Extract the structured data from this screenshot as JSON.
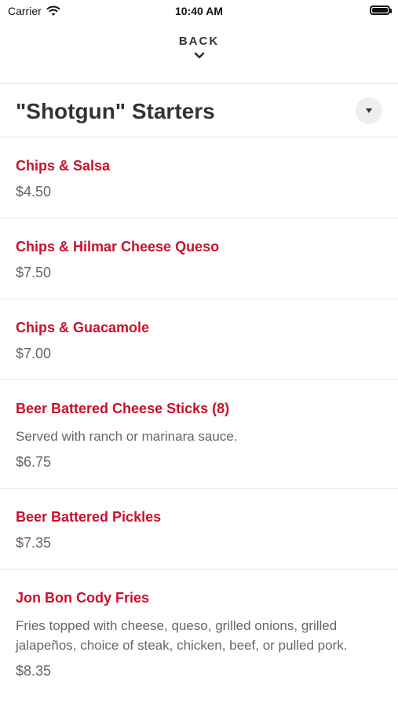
{
  "status_bar": {
    "carrier": "Carrier",
    "time": "10:40 AM"
  },
  "nav": {
    "back_label": "BACK"
  },
  "section": {
    "title": "\"Shotgun\" Starters"
  },
  "items": [
    {
      "name": "Chips & Salsa",
      "description": "",
      "price": "$4.50"
    },
    {
      "name": "Chips & Hilmar Cheese Queso",
      "description": "",
      "price": "$7.50"
    },
    {
      "name": "Chips & Guacamole",
      "description": "",
      "price": "$7.00"
    },
    {
      "name": "Beer Battered Cheese Sticks (8)",
      "description": "Served with ranch or marinara sauce.",
      "price": "$6.75"
    },
    {
      "name": "Beer Battered Pickles",
      "description": "",
      "price": "$7.35"
    },
    {
      "name": "Jon Bon Cody Fries",
      "description": "Fries topped with cheese, queso, grilled onions, grilled jalapeños, choice of steak, chicken, beef, or pulled pork.",
      "price": "$8.35"
    }
  ],
  "colors": {
    "item_name": "#c8102e",
    "text": "#333333",
    "muted": "#666666"
  }
}
